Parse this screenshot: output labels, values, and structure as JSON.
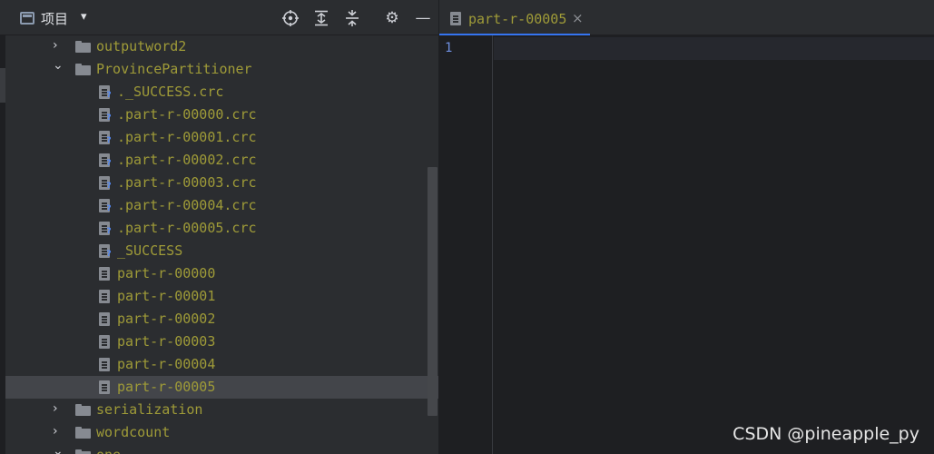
{
  "panel": {
    "title": "项目",
    "caret": "▾",
    "toolbar": {
      "locate": "⊕",
      "expand": "⇕",
      "collapse": "⇳",
      "settings": "⚙",
      "minimize": "—"
    }
  },
  "tree": [
    {
      "label": "outputword2",
      "type": "folder",
      "expanded": false,
      "chev": "›"
    },
    {
      "label": "ProvincePartitioner",
      "type": "folder",
      "expanded": true,
      "chev": "⌄"
    },
    {
      "label": "._SUCCESS.crc",
      "type": "unknown-file"
    },
    {
      "label": ".part-r-00000.crc",
      "type": "unknown-file"
    },
    {
      "label": ".part-r-00001.crc",
      "type": "unknown-file"
    },
    {
      "label": ".part-r-00002.crc",
      "type": "unknown-file"
    },
    {
      "label": ".part-r-00003.crc",
      "type": "unknown-file"
    },
    {
      "label": ".part-r-00004.crc",
      "type": "unknown-file"
    },
    {
      "label": ".part-r-00005.crc",
      "type": "unknown-file"
    },
    {
      "label": "_SUCCESS",
      "type": "unknown-file"
    },
    {
      "label": "part-r-00000",
      "type": "text-file"
    },
    {
      "label": "part-r-00001",
      "type": "text-file"
    },
    {
      "label": "part-r-00002",
      "type": "text-file"
    },
    {
      "label": "part-r-00003",
      "type": "text-file"
    },
    {
      "label": "part-r-00004",
      "type": "text-file"
    },
    {
      "label": "part-r-00005",
      "type": "text-file",
      "selected": true
    },
    {
      "label": "serialization",
      "type": "folder",
      "expanded": false,
      "chev": "›"
    },
    {
      "label": "wordcount",
      "type": "folder",
      "expanded": false,
      "chev": "›"
    },
    {
      "label": "one",
      "type": "folder",
      "expanded": true,
      "chev": "⌄"
    }
  ],
  "editor": {
    "tab_label": "part-r-00005",
    "tab_close": "×",
    "line_numbers": [
      "1"
    ]
  },
  "watermark": "CSDN @pineapple_py",
  "colors": {
    "file_label": "#9f9b38",
    "accent": "#3574f0",
    "selection": "#43454a"
  }
}
